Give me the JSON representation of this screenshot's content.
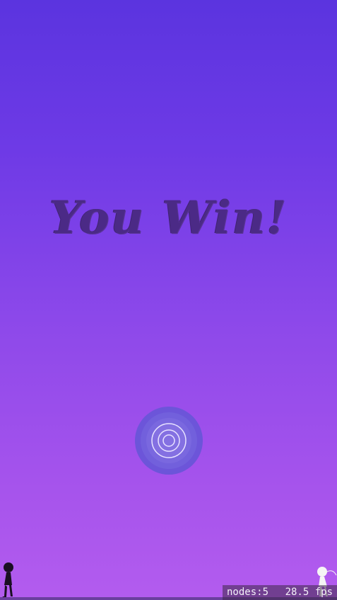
{
  "game": {
    "result_text": "You Win!",
    "colors": {
      "background_top": "#5b34df",
      "background_bottom": "#b35cee",
      "title": "#4b2a86",
      "button_outer": "#6c55d9",
      "button_inner": "#8470e2",
      "button_rings": "#e8e2ff",
      "silhouette_left": "#1a0f22",
      "silhouette_right": "#f5f5f5"
    },
    "replay_button": {
      "icon": "concentric-rings-icon"
    }
  },
  "debug_overlay": {
    "nodes": "nodes:5",
    "fps": "28.5 fps"
  }
}
